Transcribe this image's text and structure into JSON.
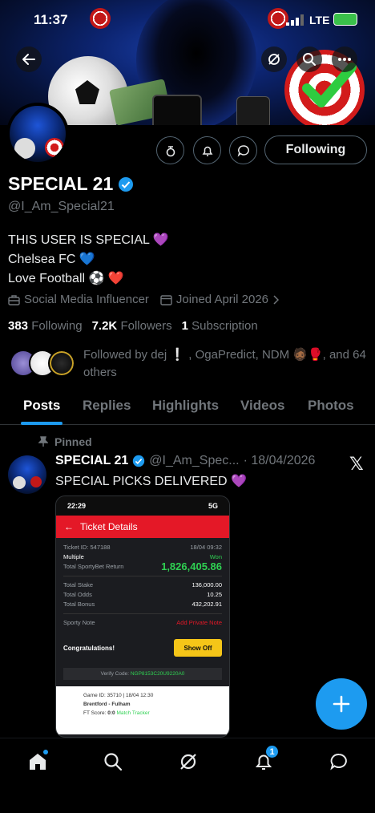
{
  "status_bar": {
    "time": "11:37",
    "network": "LTE"
  },
  "profile": {
    "name": "SPECIAL 21",
    "handle": "@I_Am_Special21",
    "following_button": "Following",
    "bio_lines": [
      "THIS USER IS SPECIAL 💜",
      "Chelsea FC 💙",
      "Love Football ⚽ ❤️"
    ],
    "category": "Social Media Influencer",
    "joined": "Joined April 2026",
    "following_count": "383",
    "following_label": "Following",
    "followers_count": "7.2K",
    "followers_label": "Followers",
    "subscription_count": "1",
    "subscription_label": "Subscription",
    "followed_by": "Followed by dej ❕ , OgaPredict, NDM 🧔🏾🥊, and 64 others"
  },
  "tabs": [
    "Posts",
    "Replies",
    "Highlights",
    "Videos",
    "Photos"
  ],
  "active_tab": "Posts",
  "post": {
    "pinned_label": "Pinned",
    "author_name": "SPECIAL 21",
    "author_handle": "@I_Am_Spec...",
    "date": "· 18/04/2026",
    "text": "SPECIAL PICKS DELIVERED 💜",
    "embedded_screenshot": {
      "time": "22:29",
      "signal": "5G",
      "title": "Ticket Details",
      "ticket_id": "Ticket ID: 547188",
      "ticket_date": "18/04 09:32",
      "bet_type": "Multiple",
      "status": "Won",
      "return_label": "Total SportyBet Return",
      "return_value": "1,826,405.86",
      "total_stake_label": "Total Stake",
      "total_stake": "136,000.00",
      "total_odds_label": "Total Odds",
      "total_odds": "10.25",
      "total_bonus_label": "Total Bonus",
      "total_bonus": "432,202.91",
      "note_label": "Sporty Note",
      "private_note": "Add Private Note",
      "congrats": "Congratulations!",
      "show_off": "Show Off",
      "verify_label": "Verify Code:",
      "verify_code": "NGP8153C20U9220A0",
      "game_id": "Game ID: 35710 | 18/04 12:30",
      "match": "Brentford - Fulham",
      "ft_score_label": "FT Score:",
      "ft_score": "0:0",
      "match_tracker": "Match Tracker"
    }
  },
  "notifications_badge": "1",
  "colors": {
    "accent": "#1d9bf0",
    "background": "#000000",
    "muted": "#71767b",
    "ticket_red": "#e41827",
    "won_green": "#2fd152"
  }
}
